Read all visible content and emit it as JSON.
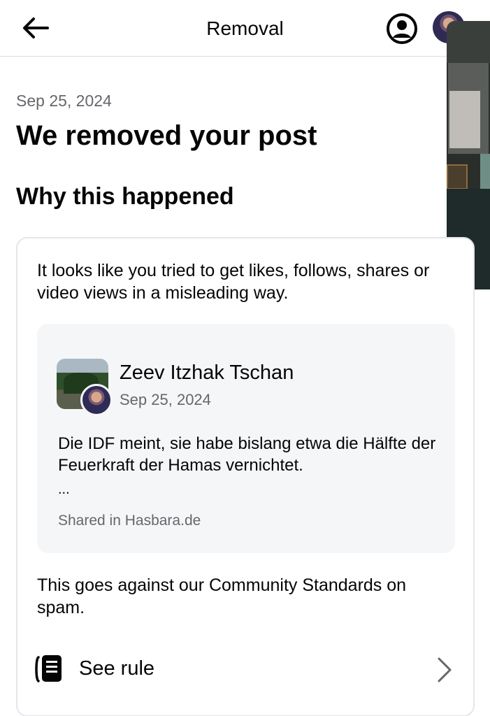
{
  "header": {
    "title": "Removal",
    "back_icon": "arrow-left-icon",
    "account_icon": "account-circle-icon"
  },
  "notice": {
    "date": "Sep 25, 2024",
    "headline": "We removed your post",
    "section_title": "Why this happened",
    "reason": "It looks like you tried to get likes, follows, shares or video views in a misleading way."
  },
  "post": {
    "author": "Zeev Itzhak Tschan",
    "date": "Sep 25, 2024",
    "text": "Die IDF meint, sie habe bislang etwa die Hälfte der Feuerkraft der Hamas vernichtet.",
    "ellipsis": "...",
    "shared_in": "Shared in Hasbara.de"
  },
  "footer": {
    "standards": "This goes against our Community Standards on spam.",
    "see_rule_label": "See rule",
    "rule_icon": "rulebook-icon",
    "chevron_icon": "chevron-right-icon"
  },
  "colors": {
    "text_primary": "#050505",
    "text_secondary": "#65676b",
    "card_border": "#e4e6eb",
    "post_background": "#f5f6f8"
  }
}
